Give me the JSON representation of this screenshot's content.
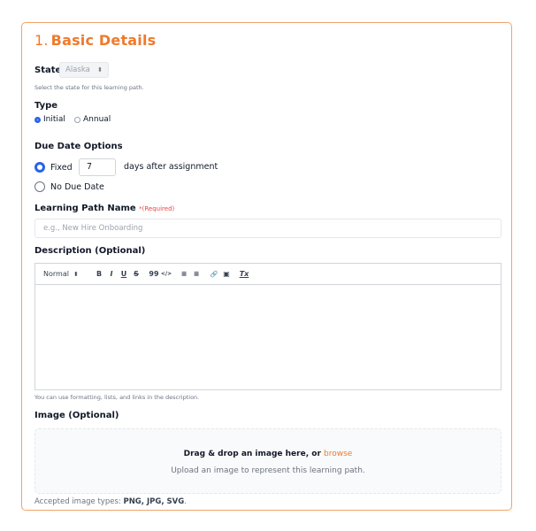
{
  "section": {
    "number": "1.",
    "title": "Basic Details"
  },
  "state": {
    "label": "State",
    "value": "Alaska",
    "help": "Select the state for this learning path."
  },
  "type": {
    "label": "Type",
    "options": [
      "Initial",
      "Annual"
    ],
    "selected": "Initial"
  },
  "due_date": {
    "label": "Due Date Options",
    "fixed_label": "Fixed",
    "days_value": "7",
    "days_suffix": "days after assignment",
    "no_due_label": "No Due Date",
    "selected": "Fixed"
  },
  "learning_path_name": {
    "label": "Learning Path Name",
    "required": "*(Required)",
    "placeholder": "e.g., New Hire Onboarding"
  },
  "description": {
    "label": "Description (Optional)",
    "toolbar": {
      "format": "Normal",
      "bold": "B",
      "italic": "I",
      "underline": "U",
      "strike": "S",
      "quote": "99",
      "code": "</>",
      "ordered_list": "≡",
      "bullet_list": "≡",
      "link": "🔗",
      "image": "▣",
      "clear": "Tx"
    },
    "help": "You can use formatting, lists, and links in the description."
  },
  "image": {
    "label": "Image (Optional)",
    "drop_text": "Drag & drop an image here, or",
    "browse": "browse",
    "subtext": "Upload an image to represent this learning path.",
    "accepted_prefix": "Accepted image types:",
    "accepted_types": "PNG, JPG, SVG",
    "accepted_suffix": "."
  },
  "colors": {
    "accent": "#ef7a2b",
    "radio_selected": "#2563eb",
    "required": "#ef4444"
  }
}
